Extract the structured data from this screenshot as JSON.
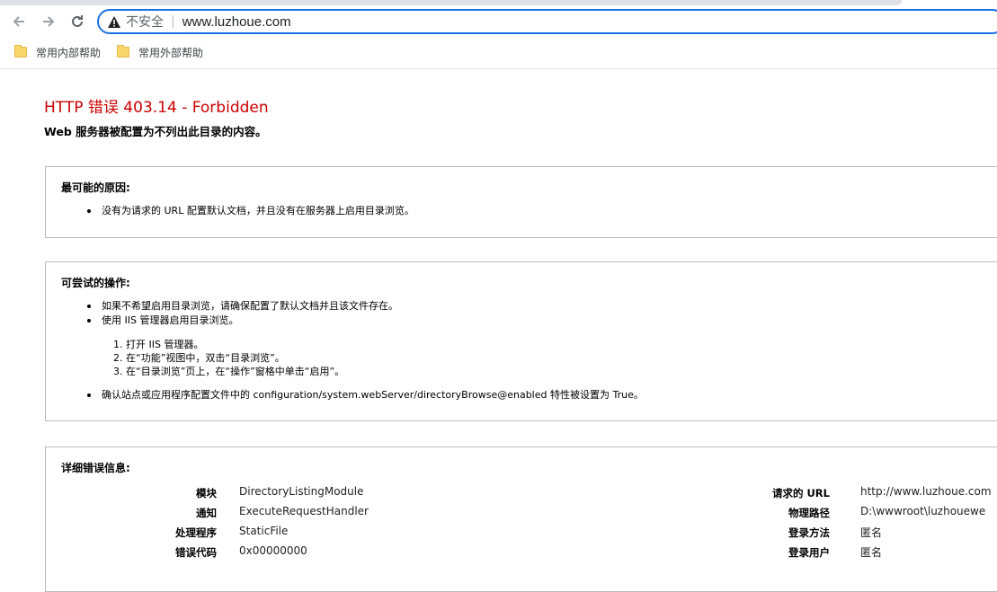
{
  "browser": {
    "security_text": "不安全",
    "url": "www.luzhoue.com",
    "bookmarks": [
      "常用内部帮助",
      "常用外部帮助"
    ]
  },
  "page": {
    "title": "HTTP 错误 403.14 - Forbidden",
    "subtitle": "Web 服务器被配置为不列出此目录的内容。",
    "cause": {
      "heading": "最可能的原因:",
      "items": [
        "没有为请求的 URL 配置默认文档，并且没有在服务器上启用目录浏览。"
      ]
    },
    "actions": {
      "heading": "可尝试的操作:",
      "item1": "如果不希望启用目录浏览，请确保配置了默认文档并且该文件存在。",
      "item2": "使用 IIS 管理器启用目录浏览。",
      "steps": [
        "1. 打开 IIS 管理器。",
        "2. 在“功能”视图中，双击“目录浏览”。",
        "3. 在“目录浏览”页上，在“操作”窗格中单击“启用”。"
      ],
      "item3": "确认站点或应用程序配置文件中的 configuration/system.webServer/directoryBrowse@enabled 特性被设置为 True。"
    },
    "details": {
      "heading": "详细错误信息:",
      "left": [
        {
          "label": "模块",
          "value": "DirectoryListingModule"
        },
        {
          "label": "通知",
          "value": "ExecuteRequestHandler"
        },
        {
          "label": "处理程序",
          "value": "StaticFile"
        },
        {
          "label": "错误代码",
          "value": "0x00000000"
        }
      ],
      "right": [
        {
          "label": "请求的 URL",
          "value": "http://www.luzhoue.com"
        },
        {
          "label": "物理路径",
          "value": "D:\\wwwroot\\luzhouewe"
        },
        {
          "label": "登录方法",
          "value": "匿名"
        },
        {
          "label": "登录用户",
          "value": "匿名"
        }
      ]
    }
  },
  "colors": {
    "error_title": "#cc0000",
    "omnibox_border": "#1a73e8"
  }
}
